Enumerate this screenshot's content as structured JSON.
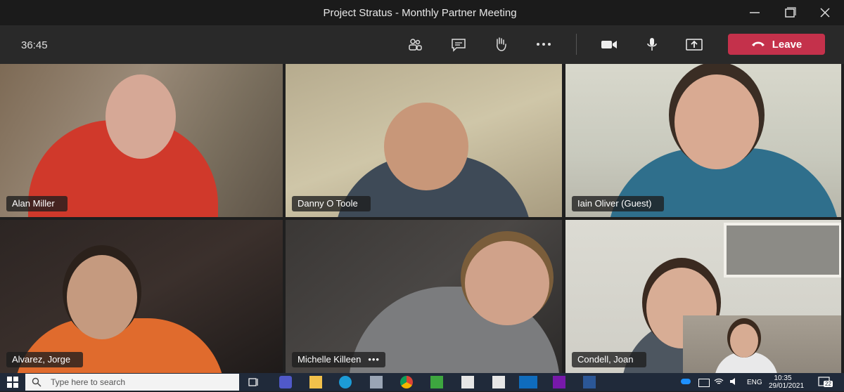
{
  "window": {
    "title": "Project Stratus - Monthly Partner Meeting"
  },
  "meeting": {
    "timer": "36:45",
    "leave_label": "Leave",
    "controls": [
      "participants-icon",
      "chat-icon",
      "raise-hand-icon",
      "more-icon",
      "camera-icon",
      "microphone-icon",
      "share-screen-icon"
    ]
  },
  "participants": [
    {
      "name": "Alan Miller",
      "more": ""
    },
    {
      "name": "Danny O Toole",
      "more": ""
    },
    {
      "name": "Iain Oliver (Guest)",
      "more": ""
    },
    {
      "name": "Alvarez, Jorge",
      "more": ""
    },
    {
      "name": "Michelle Killeen",
      "more": "•••"
    },
    {
      "name": "Condell, Joan",
      "more": ""
    }
  ],
  "taskbar": {
    "search_placeholder": "Type here to search",
    "language": "ENG",
    "time": "10:35",
    "date": "29/01/2021",
    "notification_count": "22"
  },
  "colors": {
    "leave": "#c4314b",
    "titlebar": "#1b1b1b",
    "meetbar": "#292929",
    "taskbar": "#202a3a"
  }
}
